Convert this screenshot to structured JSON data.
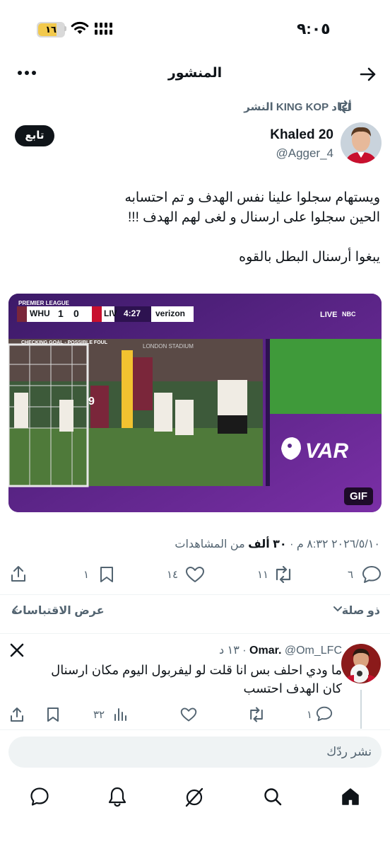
{
  "status_bar": {
    "time": "٩:٠٥",
    "battery": "١٦"
  },
  "header": {
    "title": "المنشور"
  },
  "repost": {
    "text": "أعاد KING KOP النشر"
  },
  "tweet": {
    "author_name": "Khaled 20",
    "author_handle": "@Agger_4",
    "follow_label": "تابع",
    "text_line1": "ويستهام سجلوا علينا نفس الهدف و تم احتسابه",
    "text_line2": "الحين سجلوا على ارسنال و لغى لهم الهدف !!!",
    "text_line3": "يبغوا أرسنال البطل بالقوه",
    "media": {
      "competition": "PREMIER LEAGUE",
      "home_team": "WHU",
      "home_score": "1",
      "away_score": "0",
      "away_team": "LIV",
      "clock": "4:27",
      "sponsor": "verizon",
      "live": "LIVE",
      "network": "NBC",
      "check_banner": "CHECKING GOAL - POSSIBLE FOUL",
      "stadium_board": "LONDON STADIUM",
      "player_number": "9",
      "var_label": "VAR",
      "gif_badge": "GIF"
    },
    "timestamp": "٢٠٢٦/٥/١٠ ٨:٣٢ م",
    "views_count": "٣٠ ألف",
    "views_label": "من المشاهدات",
    "separator": "·"
  },
  "actions": {
    "replies": "٦",
    "reposts": "١١",
    "likes": "١٤",
    "bookmarks": "١"
  },
  "related": {
    "right_label": "ذو صلة",
    "left_label": "عرض الاقتباسات"
  },
  "reply": {
    "author_name": "Omar.",
    "author_handle": "@Om_LFC",
    "separator": "·",
    "time": "١٣ د",
    "text": "ما ودي احلف بس انا قلت لو ليفربول اليوم مكان ارسنال كان الهدف احتسب",
    "replies": "١",
    "views": "٣٢"
  },
  "composer": {
    "placeholder": "نشر ردّك"
  },
  "colors": {
    "accent": "#0f1419",
    "muted": "#536471",
    "media_purple": "#5b2a8a",
    "battery": "#f2c94c"
  },
  "icons": [
    "back-arrow-icon",
    "more-icon",
    "repost-icon",
    "reply-icon",
    "like-icon",
    "bookmark-icon",
    "share-icon",
    "x-logo-icon",
    "views-icon",
    "home-icon",
    "search-icon",
    "grok-icon",
    "bell-icon",
    "messages-icon"
  ]
}
